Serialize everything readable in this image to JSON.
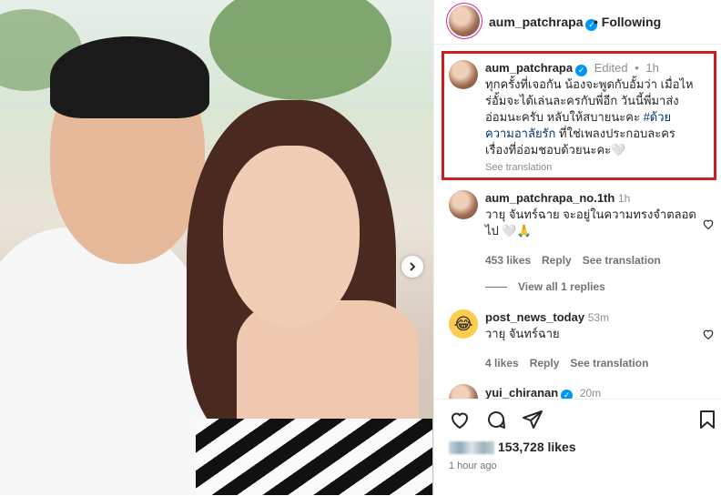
{
  "post": {
    "author": "aum_patchrapa",
    "follow_state": "Following",
    "time_ago": "1 hour ago",
    "likes_count": "153,728 likes"
  },
  "caption": {
    "username": "aum_patchrapa",
    "edited_label": "Edited",
    "time": "1h",
    "text_main": "ทุกครั้งที่เจอกัน น้องจะพูดกับอั้มว่า เมื่อไหร่อั้มจะได้เล่นละครกับพี่อีก วันนี้พี่มาส่งอ่อมนะครับ หลับให้สบายนะคะ ",
    "hashtag": "#ด้วยความอาลัยรัก",
    "text_tail": " ที่ใช่เพลงประกอบละคร เรื่องที่อ่อมชอบด้วยนะคะ🤍",
    "see_translation": "See translation"
  },
  "comments": [
    {
      "username": "aum_patchrapa_no.1th",
      "time": "1h",
      "text": "วายุ จันทร์ฉาย จะอยู่ในความทรงจำตลอดไป 🤍🙏",
      "likes": "453 likes",
      "reply": "Reply",
      "see_translation": "See translation",
      "view_replies": "View all 1 replies"
    },
    {
      "username": "post_news_today",
      "time": "53m",
      "text": "วายุ จันทร์ฉาย",
      "likes": "4 likes",
      "reply": "Reply",
      "see_translation": "See translation"
    },
    {
      "username": "yui_chiranan",
      "time": "20m"
    }
  ],
  "icons": {
    "verified": "verified-badge-icon",
    "heart": "heart-icon",
    "comment": "comment-icon",
    "share": "share-icon",
    "save": "bookmark-icon",
    "next": "chevron-right-icon",
    "emoji": "laughing-emoji-icon"
  },
  "colors": {
    "highlight_box": "#d01c1c",
    "verified": "#0095f6",
    "link": "#00376b"
  }
}
